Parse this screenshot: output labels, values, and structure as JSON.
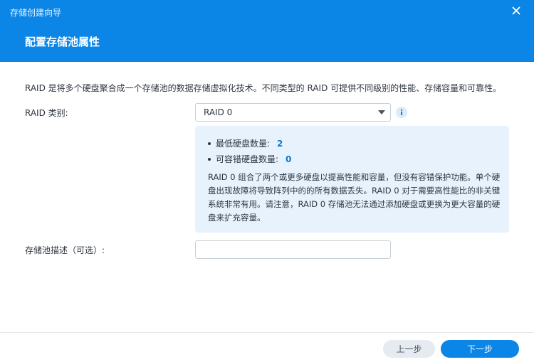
{
  "window": {
    "title": "存储创建向导",
    "close_icon": "close-icon"
  },
  "header": {
    "page_title": "配置存储池属性"
  },
  "main": {
    "description": "RAID 是将多个硬盘聚合成一个存储池的数据存储虚拟化技术。不同类型的 RAID 可提供不同级别的性能、存储容量和可靠性。",
    "raid_type": {
      "label": "RAID 类别:",
      "selected": "RAID 0",
      "arrow_icon": "chevron-down-icon",
      "info_icon": "info-icon"
    },
    "info_box": {
      "min_disks_label": "最低硬盘数量:",
      "min_disks_value": "2",
      "fault_tolerance_label": "可容错硬盘数量:",
      "fault_tolerance_value": "0",
      "paragraph": "RAID 0 组合了两个或更多硬盘以提高性能和容量，但没有容错保护功能。单个硬盘出现故障将导致阵列中的的所有数据丢失。RAID 0 对于需要高性能比的非关键系统非常有用。请注意，RAID 0 存储池无法通过添加硬盘或更换为更大容量的硬盘来扩充容量。"
    },
    "pool_description": {
      "label": "存储池描述（可选）:",
      "value": "",
      "placeholder": ""
    }
  },
  "footer": {
    "back_label": "上一步",
    "next_label": "下一步"
  },
  "colors": {
    "accent": "#0b85e6",
    "info_background": "#e7f2fd",
    "highlight_number": "#0b7ad1"
  }
}
